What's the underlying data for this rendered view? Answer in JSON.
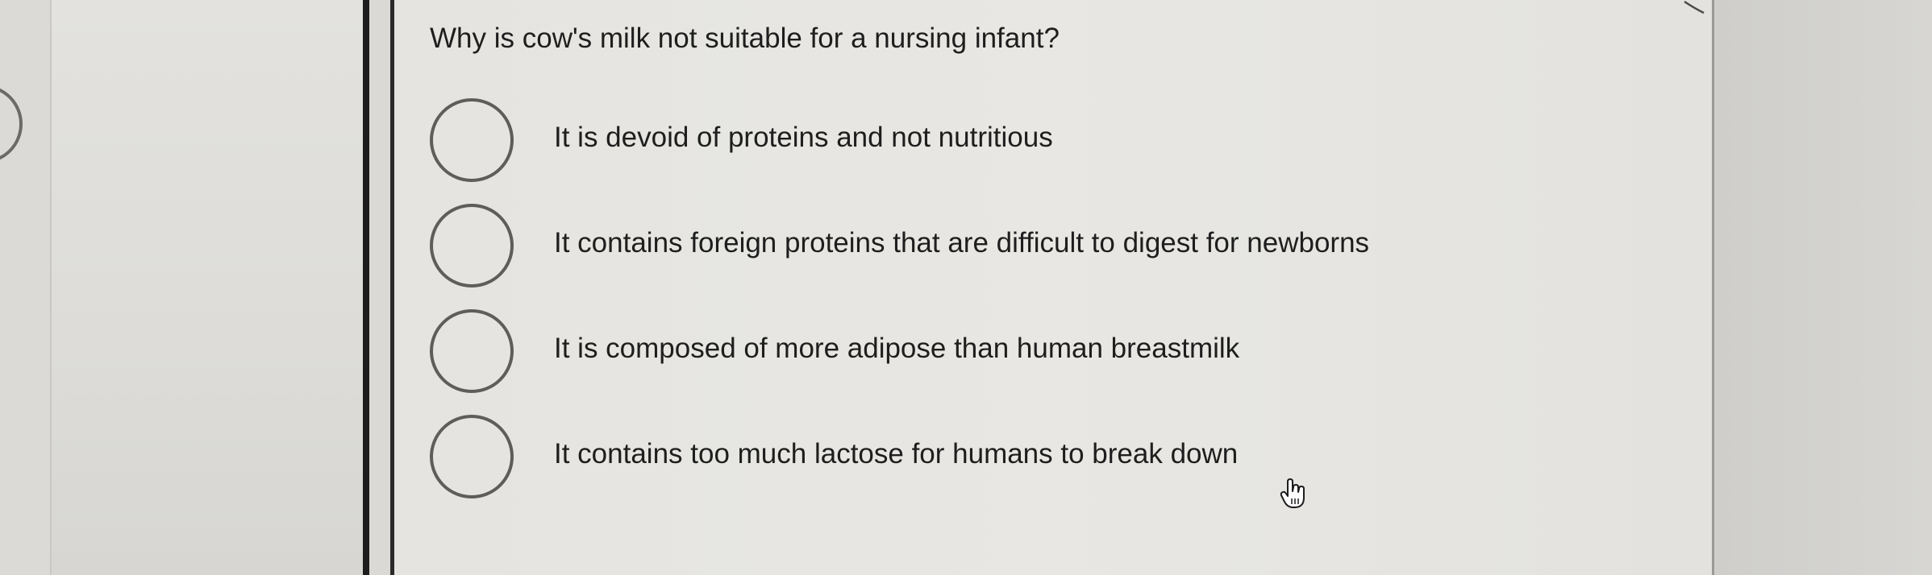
{
  "question": {
    "text": "Why is cow's milk not suitable for a nursing infant?"
  },
  "options": [
    {
      "label": "It is devoid of proteins and not nutritious",
      "selected": false
    },
    {
      "label": "It contains foreign proteins that are difficult to digest for newborns",
      "selected": false
    },
    {
      "label": "It is composed of more adipose than human breastmilk",
      "selected": false
    },
    {
      "label": "It contains too much lactose for humans to break down",
      "selected": false
    }
  ],
  "icons": {
    "cursor": "hand-pointer-icon",
    "radio": "radio-unselected-icon"
  },
  "colors": {
    "text": "#1e1e1e",
    "radio_border": "#5d5d5b",
    "panel_background": "#e6e5e1",
    "frame_border": "#1d1d1d"
  }
}
